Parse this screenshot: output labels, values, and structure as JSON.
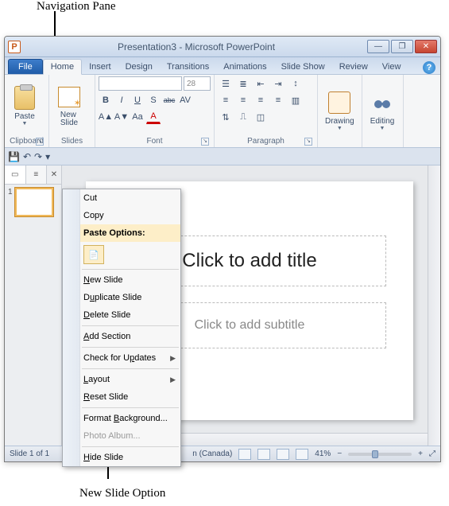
{
  "annotations": {
    "nav_pane": "Navigation Pane",
    "new_slide_option": "New Slide Option"
  },
  "window": {
    "app_letter": "P",
    "title": "Presentation3 - Microsoft PowerPoint",
    "buttons": {
      "min": "—",
      "max": "❐",
      "close": "✕"
    },
    "help": "?"
  },
  "tabs": {
    "file": "File",
    "items": [
      "Home",
      "Insert",
      "Design",
      "Transitions",
      "Animations",
      "Slide Show",
      "Review",
      "View"
    ],
    "active": "Home"
  },
  "ribbon": {
    "clipboard": {
      "paste": "Paste",
      "label": "Clipboard"
    },
    "slides": {
      "new_slide": "New\nSlide",
      "label": "Slides"
    },
    "font": {
      "label": "Font",
      "size_value": "28",
      "buttons_row1": [
        "B",
        "I",
        "U",
        "S",
        "abc",
        "AV"
      ],
      "buttons_row2": [
        "A▲",
        "A▼",
        "Aa",
        "A"
      ]
    },
    "paragraph": {
      "label": "Paragraph"
    },
    "drawing": {
      "label": "Drawing",
      "btn": "Drawing"
    },
    "editing": {
      "label": "Editing",
      "btn": "Editing"
    }
  },
  "qat": {
    "save": "💾",
    "undo": "↶",
    "redo": "↷",
    "dd": "▾"
  },
  "nav": {
    "thumb_number": "1"
  },
  "slide": {
    "title_ph": "Click to add title",
    "subtitle_ph": "Click to add subtitle"
  },
  "context_menu": {
    "cut": "Cut",
    "copy": "Copy",
    "paste_options": "Paste Options:",
    "new_slide": "New Slide",
    "duplicate_slide": "Duplicate Slide",
    "delete_slide": "Delete Slide",
    "add_section": "Add Section",
    "check_updates": "Check for Updates",
    "layout": "Layout",
    "reset_slide": "Reset Slide",
    "format_background": "Format Background...",
    "photo_album": "Photo Album...",
    "hide_slide": "Hide Slide"
  },
  "status": {
    "slide_info": "Slide 1 of 1",
    "lang": "n (Canada)",
    "zoom": "41%",
    "minus": "−",
    "plus": "+",
    "fit": "⤢"
  }
}
